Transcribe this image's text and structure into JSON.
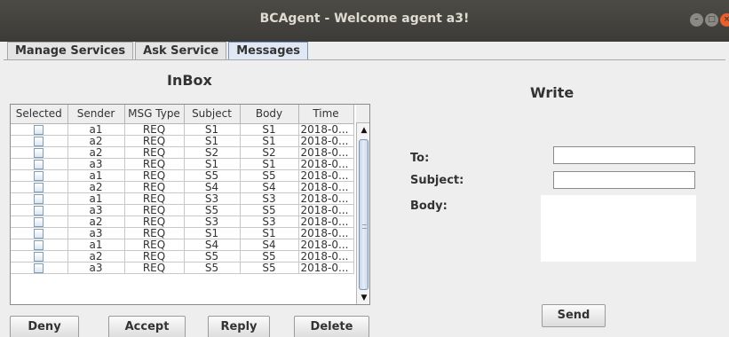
{
  "window": {
    "title": "BCAgent - Welcome agent a3!"
  },
  "tabs": [
    "Manage Services",
    "Ask Service",
    "Messages"
  ],
  "inbox": {
    "title": "InBox",
    "columns": [
      "Selected",
      "Sender",
      "MSG Type",
      "Subject",
      "Body",
      "Time"
    ],
    "rows": [
      {
        "sender": "a1",
        "type": "REQ",
        "subject": "S1",
        "body": "S1",
        "time": "2018-0..."
      },
      {
        "sender": "a2",
        "type": "REQ",
        "subject": "S1",
        "body": "S1",
        "time": "2018-0..."
      },
      {
        "sender": "a2",
        "type": "REQ",
        "subject": "S2",
        "body": "S2",
        "time": "2018-0..."
      },
      {
        "sender": "a3",
        "type": "REQ",
        "subject": "S1",
        "body": "S1",
        "time": "2018-0..."
      },
      {
        "sender": "a1",
        "type": "REQ",
        "subject": "S5",
        "body": "S5",
        "time": "2018-0..."
      },
      {
        "sender": "a2",
        "type": "REQ",
        "subject": "S4",
        "body": "S4",
        "time": "2018-0..."
      },
      {
        "sender": "a1",
        "type": "REQ",
        "subject": "S3",
        "body": "S3",
        "time": "2018-0..."
      },
      {
        "sender": "a3",
        "type": "REQ",
        "subject": "S5",
        "body": "S5",
        "time": "2018-0..."
      },
      {
        "sender": "a2",
        "type": "REQ",
        "subject": "S3",
        "body": "S3",
        "time": "2018-0..."
      },
      {
        "sender": "a3",
        "type": "REQ",
        "subject": "S1",
        "body": "S1",
        "time": "2018-0..."
      },
      {
        "sender": "a1",
        "type": "REQ",
        "subject": "S4",
        "body": "S4",
        "time": "2018-0..."
      },
      {
        "sender": "a2",
        "type": "REQ",
        "subject": "S5",
        "body": "S5",
        "time": "2018-0..."
      },
      {
        "sender": "a3",
        "type": "REQ",
        "subject": "S5",
        "body": "S5",
        "time": "2018-0..."
      }
    ]
  },
  "buttons": {
    "deny": "Deny",
    "accept": "Accept",
    "reply": "Reply",
    "delete": "Delete",
    "send": "Send"
  },
  "write": {
    "title": "Write",
    "to_label": "To:",
    "subject_label": "Subject:",
    "body_label": "Body:",
    "to_value": "",
    "subject_value": ""
  },
  "icons": {
    "minimize": "minimize-icon",
    "maximize": "maximize-icon",
    "close": "close-icon"
  },
  "colors": {
    "titlebar": "#3c3b37",
    "close_button": "#ea5f2a",
    "active_tab": "#dfe8f4"
  }
}
